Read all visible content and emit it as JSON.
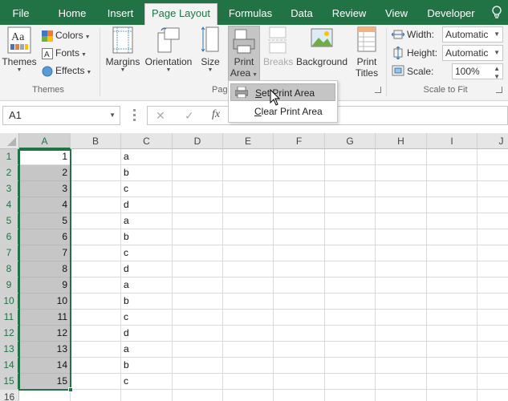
{
  "tabs": [
    {
      "label": "File",
      "active": false
    },
    {
      "label": "Home",
      "active": false
    },
    {
      "label": "Insert",
      "active": false
    },
    {
      "label": "Page Layout",
      "active": true
    },
    {
      "label": "Formulas",
      "active": false
    },
    {
      "label": "Data",
      "active": false
    },
    {
      "label": "Review",
      "active": false
    },
    {
      "label": "View",
      "active": false
    },
    {
      "label": "Developer",
      "active": false
    }
  ],
  "ribbon": {
    "themes": {
      "themes_label": "Themes",
      "colors_label": "Colors",
      "fonts_label": "Fonts",
      "effects_label": "Effects",
      "group_label": "Themes"
    },
    "page_setup": {
      "margins_label": "Margins",
      "orientation_label": "Orientation",
      "size_label": "Size",
      "print_area_line1": "Print",
      "print_area_line2": "Area",
      "breaks_label": "Breaks",
      "background_label": "Background",
      "print_titles_line1": "Print",
      "print_titles_line2": "Titles",
      "group_label_partial": "Pag"
    },
    "scale": {
      "width_label": "Width:",
      "width_value": "Automatic",
      "height_label": "Height:",
      "height_value": "Automatic",
      "scale_label": "Scale:",
      "scale_value": "100%",
      "group_label": "Scale to Fit"
    }
  },
  "formula_bar": {
    "name_box": "A1",
    "cancel_icon": "✕",
    "enter_icon": "✓",
    "fx_label": "fx",
    "formula": ""
  },
  "print_area_menu": {
    "set_label_u": "S",
    "set_label_rest": "et Print Area",
    "clear_label_u": "C",
    "clear_label_rest": "lear Print Area"
  },
  "sheet": {
    "columns": [
      "A",
      "B",
      "C",
      "D",
      "E",
      "F",
      "G",
      "H",
      "I",
      "J"
    ],
    "rows": [
      {
        "num": "1",
        "a": "1",
        "c": "a"
      },
      {
        "num": "2",
        "a": "2",
        "c": "b"
      },
      {
        "num": "3",
        "a": "3",
        "c": "c"
      },
      {
        "num": "4",
        "a": "4",
        "c": "d"
      },
      {
        "num": "5",
        "a": "5",
        "c": "a"
      },
      {
        "num": "6",
        "a": "6",
        "c": "b"
      },
      {
        "num": "7",
        "a": "7",
        "c": "c"
      },
      {
        "num": "8",
        "a": "8",
        "c": "d"
      },
      {
        "num": "9",
        "a": "9",
        "c": "a"
      },
      {
        "num": "10",
        "a": "10",
        "c": "b"
      },
      {
        "num": "11",
        "a": "11",
        "c": "c"
      },
      {
        "num": "12",
        "a": "12",
        "c": "d"
      },
      {
        "num": "13",
        "a": "13",
        "c": "a"
      },
      {
        "num": "14",
        "a": "14",
        "c": "b"
      },
      {
        "num": "15",
        "a": "15",
        "c": "c"
      },
      {
        "num": "16",
        "a": "",
        "c": ""
      }
    ],
    "selection": "A1:A15"
  },
  "colors": {
    "accent": "#217346",
    "selection_fill": "#c6c6c6"
  }
}
